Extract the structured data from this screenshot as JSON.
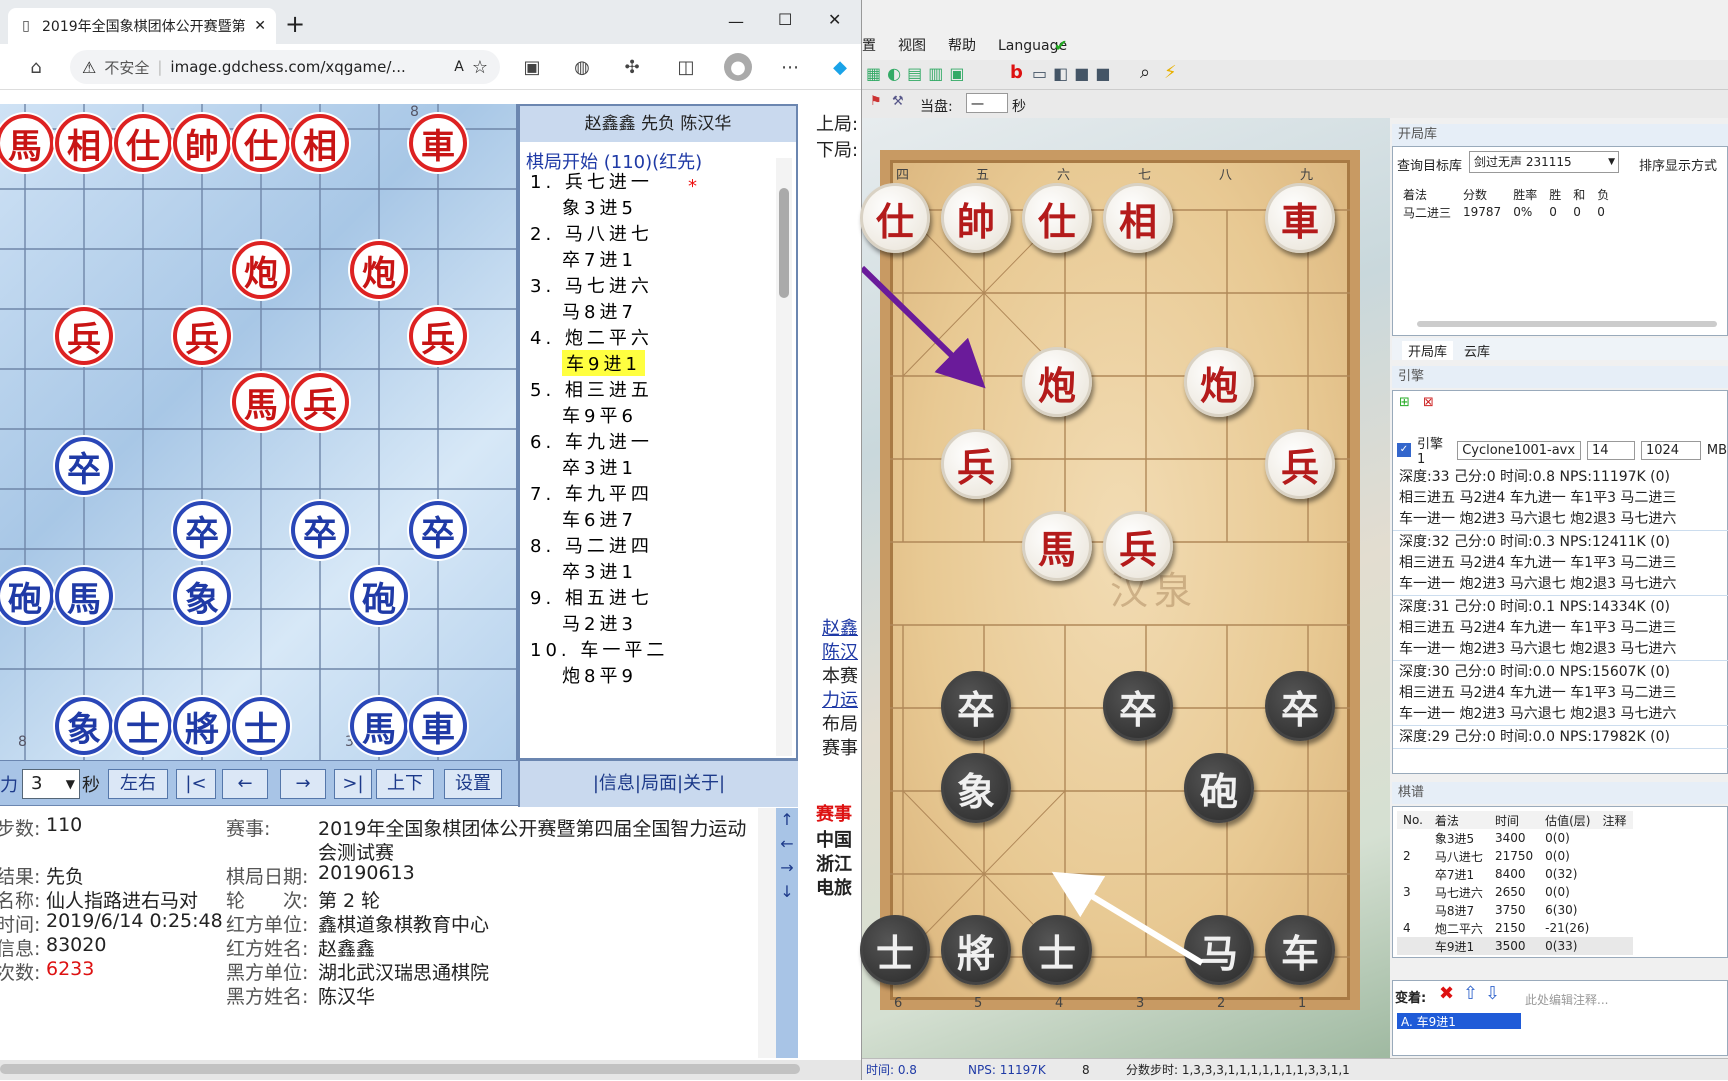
{
  "browser": {
    "tab_title": "2019年全国象棋团体公开赛暨第四",
    "new_tab": "+",
    "url_warning": "不安全",
    "url": "image.gdchess.com/xqgame/..."
  },
  "board": {
    "mark_top": "8",
    "mark_bottom_left": "8",
    "mark_bottom_mid": "3",
    "pieces": [
      {
        "t": "馬",
        "c": "r"
      },
      {
        "t": "相",
        "c": "r"
      },
      {
        "t": "仕",
        "c": "r"
      },
      {
        "t": "帥",
        "c": "r"
      },
      {
        "t": "仕",
        "c": "r"
      },
      {
        "t": "相",
        "c": "r"
      },
      {
        "t": "車",
        "c": "r"
      },
      {
        "t": "炮",
        "c": "r"
      },
      {
        "t": "炮",
        "c": "r"
      },
      {
        "t": "兵",
        "c": "r"
      },
      {
        "t": "兵",
        "c": "r"
      },
      {
        "t": "兵",
        "c": "r"
      },
      {
        "t": "馬",
        "c": "r"
      },
      {
        "t": "兵",
        "c": "r"
      },
      {
        "t": "卒",
        "c": "b"
      },
      {
        "t": "卒",
        "c": "b"
      },
      {
        "t": "卒",
        "c": "b"
      },
      {
        "t": "卒",
        "c": "b"
      },
      {
        "t": "砲",
        "c": "b"
      },
      {
        "t": "馬",
        "c": "b"
      },
      {
        "t": "象",
        "c": "b"
      },
      {
        "t": "砲",
        "c": "b"
      },
      {
        "t": "象",
        "c": "b"
      },
      {
        "t": "士",
        "c": "b"
      },
      {
        "t": "將",
        "c": "b"
      },
      {
        "t": "士",
        "c": "b"
      },
      {
        "t": "馬",
        "c": "b"
      },
      {
        "t": "車",
        "c": "b"
      }
    ]
  },
  "moves": {
    "header": "赵鑫鑫 先负 陈汉华",
    "start": "棋局开始 (110)(红先)",
    "star": "*",
    "list": [
      "1. 兵七进一",
      "象3进5",
      "2. 马八进七",
      "卒7进1",
      "3. 马七进六",
      "马8进7",
      "4. 炮二平六",
      "车9进1",
      "5. 相三进五",
      "车9平6",
      "6. 车九进一",
      "卒3进1",
      "7. 车九平四",
      "车6进7",
      "8. 马二进四",
      "卒3进1",
      "9. 相五进七",
      "马2进3",
      "10. 车一平二",
      "炮8平9"
    ],
    "footer": "|信息|局面|关于|"
  },
  "side": {
    "up": "上局:",
    "down": "下局:",
    "links": [
      "赵鑫",
      "陈汉",
      "本赛",
      "力运",
      "布局",
      "赛事"
    ],
    "red": "赛事",
    "bold": [
      "中国",
      "浙江",
      "电旅"
    ]
  },
  "controls": {
    "speed": "3",
    "sec": "秒",
    "buttons": [
      "左右",
      "|<",
      "←",
      "→",
      ">|",
      "上下",
      "设置"
    ]
  },
  "info": {
    "rows": [
      [
        "步数:",
        "110",
        "赛事:",
        "2019年全国象棋团体公开赛暨第四届全国智力运动"
      ],
      [
        "",
        "",
        "",
        "会测试赛"
      ],
      [
        "结果:",
        "先负",
        "棋局日期:",
        "20190613"
      ],
      [
        "名称:",
        "仙人指路进右马对",
        "轮　　次:",
        "第 2 轮"
      ],
      [
        "时间:",
        "2019/6/14 0:25:48",
        "红方单位:",
        "鑫棋道象棋教育中心"
      ],
      [
        "信息:",
        "83020",
        "红方姓名:",
        "赵鑫鑫"
      ],
      [
        "次数:",
        "6233",
        "黑方单位:",
        "湖北武汉瑞思通棋院"
      ],
      [
        "",
        "",
        "黑方姓名:",
        "陈汉华"
      ]
    ]
  },
  "app": {
    "menu": [
      "置",
      "视图",
      "帮助",
      "Language"
    ],
    "current": "当盘:",
    "current_val": "一",
    "sec": "秒",
    "book": {
      "title": "开局库",
      "query": "查询目标库",
      "lib": "剑过无声 231115",
      "sort": "排序显示方式",
      "cols": [
        "着法",
        "分数",
        "胜率",
        "胜",
        "和",
        "负"
      ],
      "row": [
        "马二进三",
        "19787",
        "0%",
        "0",
        "0",
        "0"
      ],
      "tabs": [
        "开局库",
        "云库"
      ]
    },
    "engine": {
      "title": "引擎",
      "name": "引擎1",
      "exe": "Cyclone1001-avx",
      "threads": "14",
      "hash": "1024",
      "mb": "MB",
      "lines": [
        {
          "h": "深度:33  己分:0  时间:0.8  NPS:11197K  (0)",
          "a": "相三进五 马2进4 车九进一 车1平3 马二进三",
          "b": "车一进一 炮2进3 马六退七 炮2退3 马七进六"
        },
        {
          "h": "深度:32  己分:0  时间:0.3  NPS:12411K  (0)",
          "a": "相三进五 马2进4 车九进一 车1平3 马二进三",
          "b": "车一进一 炮2进3 马六退七 炮2退3 马七进六"
        },
        {
          "h": "深度:31  己分:0  时间:0.1  NPS:14334K  (0)",
          "a": "相三进五 马2进4 车九进一 车1平3 马二进三",
          "b": "车一进一 炮2进3 马六退七 炮2退3 马七进六"
        },
        {
          "h": "深度:30  己分:0  时间:0.0  NPS:15607K  (0)",
          "a": "相三进五 马2进4 车九进一 车1平3 马二进三",
          "b": "车一进一 炮2进3 马六退七 炮2退3 马七进六"
        },
        {
          "h": "深度:29  己分:0  时间:0.0  NPS:17982K  (0)",
          "a": "",
          "b": ""
        }
      ]
    },
    "record": {
      "title": "棋谱",
      "cols": [
        "No.",
        "着法",
        "时间",
        "估值(层)",
        "注释"
      ],
      "rows": [
        [
          "",
          "象3进5",
          "3400",
          "0(0)"
        ],
        [
          "2",
          "马八进七",
          "21750",
          "0(0)"
        ],
        [
          "",
          "卒7进1",
          "8400",
          "0(32)"
        ],
        [
          "3",
          "马七进六",
          "2650",
          "0(0)"
        ],
        [
          "",
          "马8进7",
          "3750",
          "6(30)"
        ],
        [
          "4",
          "炮二平六",
          "2150",
          "-21(26)"
        ],
        [
          "",
          "车9进1",
          "3500",
          "0(33)"
        ]
      ],
      "var": "变着:",
      "note": "此处编辑注释...",
      "sel": "A. 车9进1"
    },
    "files_top": [
      "四",
      "五",
      "六",
      "七",
      "八",
      "九"
    ],
    "files_bottom": [
      "6",
      "5",
      "4",
      "3",
      "2",
      "1"
    ],
    "pieces": [
      {
        "t": "仕",
        "c": "r"
      },
      {
        "t": "帥",
        "c": "r"
      },
      {
        "t": "仕",
        "c": "r"
      },
      {
        "t": "相",
        "c": "r"
      },
      {
        "t": "車",
        "c": "r"
      },
      {
        "t": "炮",
        "c": "r"
      },
      {
        "t": "炮",
        "c": "r"
      },
      {
        "t": "兵",
        "c": "r"
      },
      {
        "t": "兵",
        "c": "r"
      },
      {
        "t": "馬",
        "c": "r"
      },
      {
        "t": "兵",
        "c": "r"
      },
      {
        "t": "卒",
        "c": "b"
      },
      {
        "t": "卒",
        "c": "b"
      },
      {
        "t": "卒",
        "c": "b"
      },
      {
        "t": "象",
        "c": "b"
      },
      {
        "t": "砲",
        "c": "b"
      },
      {
        "t": "士",
        "c": "b"
      },
      {
        "t": "將",
        "c": "b"
      },
      {
        "t": "士",
        "c": "b"
      },
      {
        "t": "马",
        "c": "b"
      },
      {
        "t": "车",
        "c": "b"
      }
    ],
    "watermark": "汉泉",
    "status": {
      "time": "时间: 0.8",
      "nps": "NPS: 11197K",
      "n": "8",
      "steps": "分数步时: 1,3,3,3,1,1,1,1,1,1,1,3,3,1,1"
    }
  },
  "colors": {
    "red": "#c81414",
    "blue": "#1f3aa6",
    "highlight": "#ffff40"
  }
}
